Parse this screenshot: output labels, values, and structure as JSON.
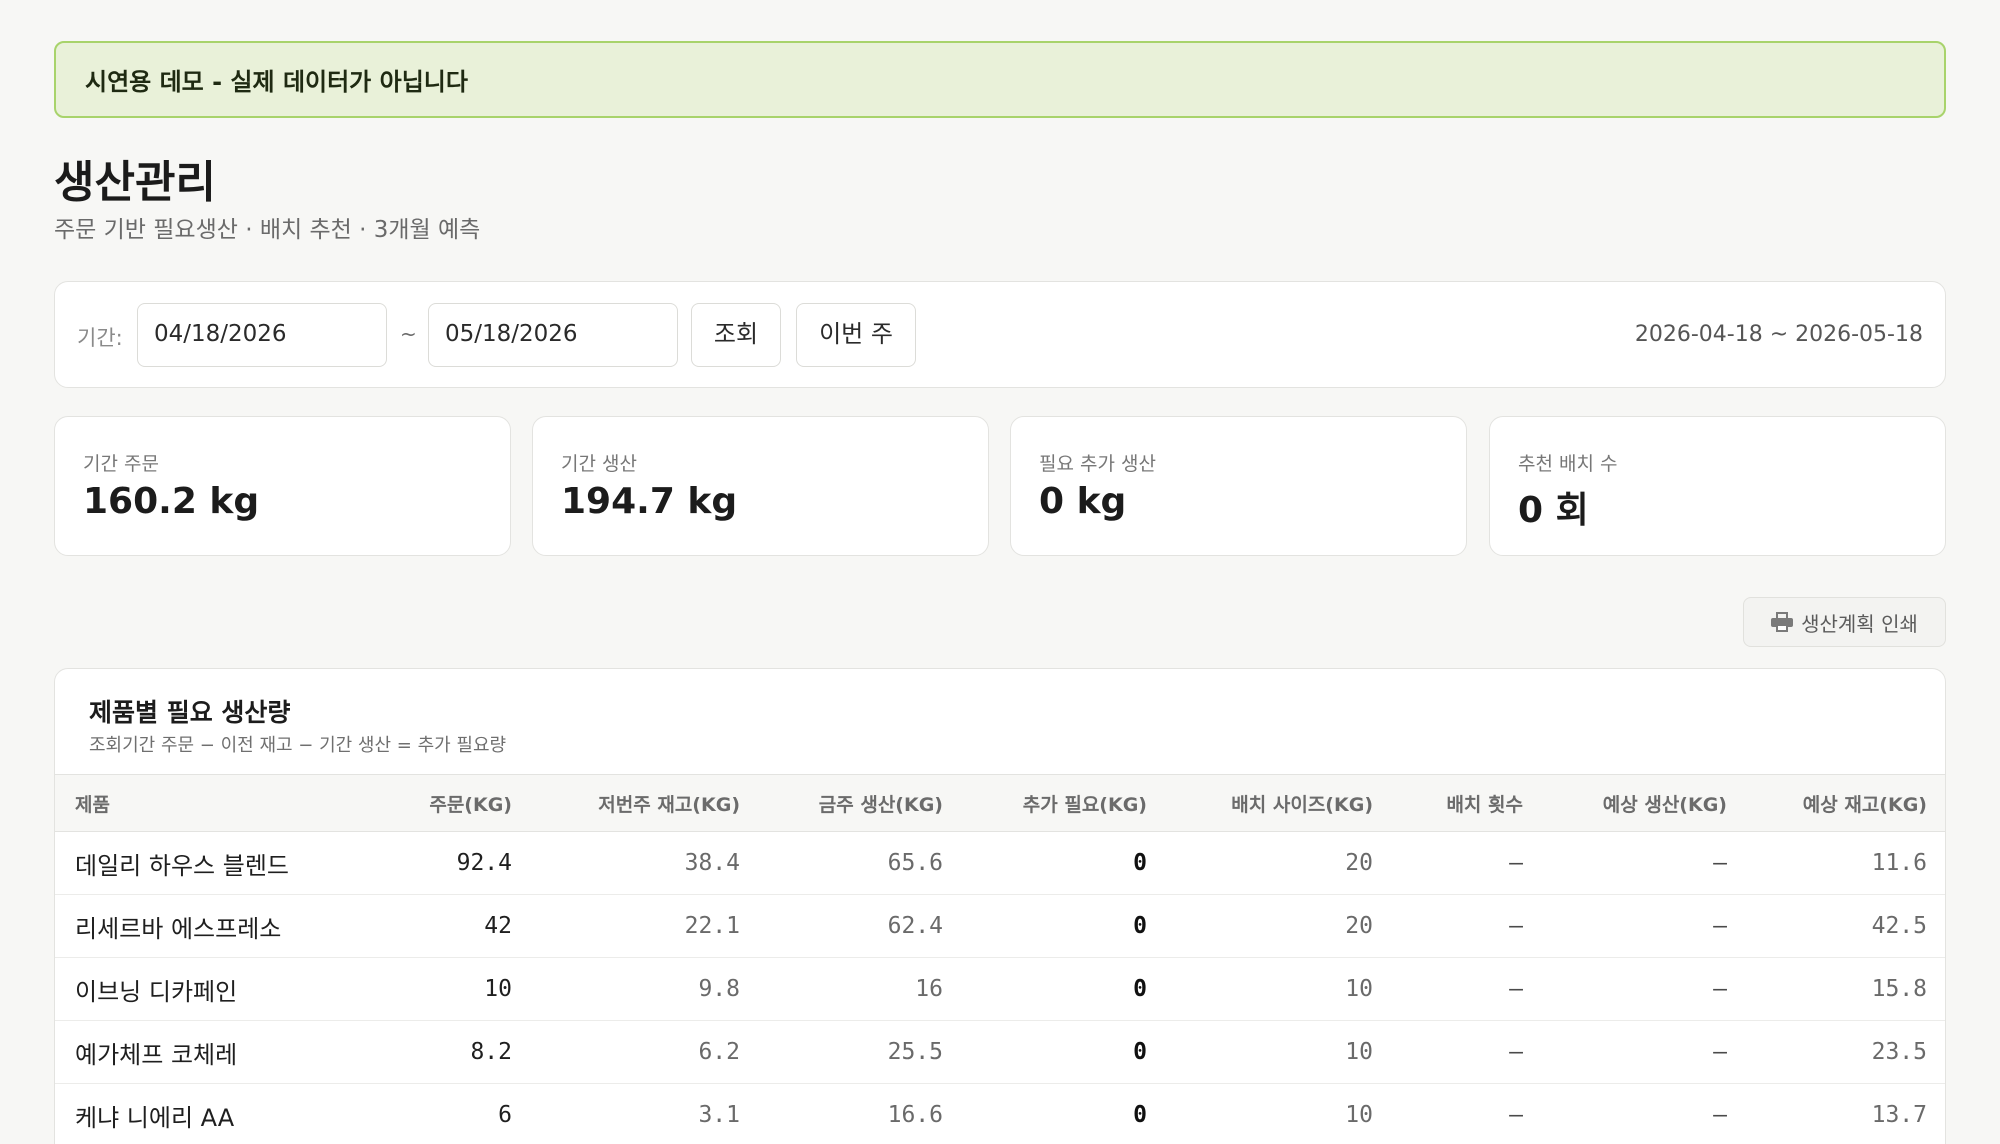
{
  "banner": {
    "text": "시연용 데모 - 실제 데이터가 아닙니다"
  },
  "header": {
    "title": "생산관리",
    "subtitle": "주문 기반 필요생산 · 배치 추천 · 3개월 예측"
  },
  "filter": {
    "label": "기간:",
    "start_date": "04/18/2026",
    "separator": "~",
    "end_date": "05/18/2026",
    "search_label": "조회",
    "this_week_label": "이번 주",
    "range_display": "2026-04-18 ~ 2026-05-18"
  },
  "stats": [
    {
      "label": "기간 주문",
      "value": "160.2 kg"
    },
    {
      "label": "기간 생산",
      "value": "194.7 kg"
    },
    {
      "label": "필요 추가 생산",
      "value": "0 kg"
    },
    {
      "label": "추천 배치 수",
      "value": "0 회"
    }
  ],
  "print_button": {
    "label": "생산계획 인쇄",
    "icon": "printer-icon"
  },
  "table": {
    "title": "제품별 필요 생산량",
    "subtitle": "조회기간 주문 − 이전 재고 − 기간 생산 = 추가 필요량",
    "columns": [
      "제품",
      "주문(KG)",
      "저번주 재고(KG)",
      "금주 생산(KG)",
      "추가 필요(KG)",
      "배치 사이즈(KG)",
      "배치 횟수",
      "예상 생산(KG)",
      "예상 재고(KG)"
    ],
    "rows": [
      {
        "product": "데일리 하우스 블렌드",
        "order": "92.4",
        "prev_stock": "38.4",
        "production": "65.6",
        "additional": "0",
        "batch_size": "20",
        "batch_count": "—",
        "expected_production": "—",
        "expected_stock": "11.6"
      },
      {
        "product": "리세르바 에스프레소",
        "order": "42",
        "prev_stock": "22.1",
        "production": "62.4",
        "additional": "0",
        "batch_size": "20",
        "batch_count": "—",
        "expected_production": "—",
        "expected_stock": "42.5"
      },
      {
        "product": "이브닝 디카페인",
        "order": "10",
        "prev_stock": "9.8",
        "production": "16",
        "additional": "0",
        "batch_size": "10",
        "batch_count": "—",
        "expected_production": "—",
        "expected_stock": "15.8"
      },
      {
        "product": "예가체프 코체레",
        "order": "8.2",
        "prev_stock": "6.2",
        "production": "25.5",
        "additional": "0",
        "batch_size": "10",
        "batch_count": "—",
        "expected_production": "—",
        "expected_stock": "23.5"
      },
      {
        "product": "케냐 니에리 AA",
        "order": "6",
        "prev_stock": "3.1",
        "production": "16.6",
        "additional": "0",
        "batch_size": "10",
        "batch_count": "—",
        "expected_production": "—",
        "expected_stock": "13.7"
      }
    ]
  }
}
